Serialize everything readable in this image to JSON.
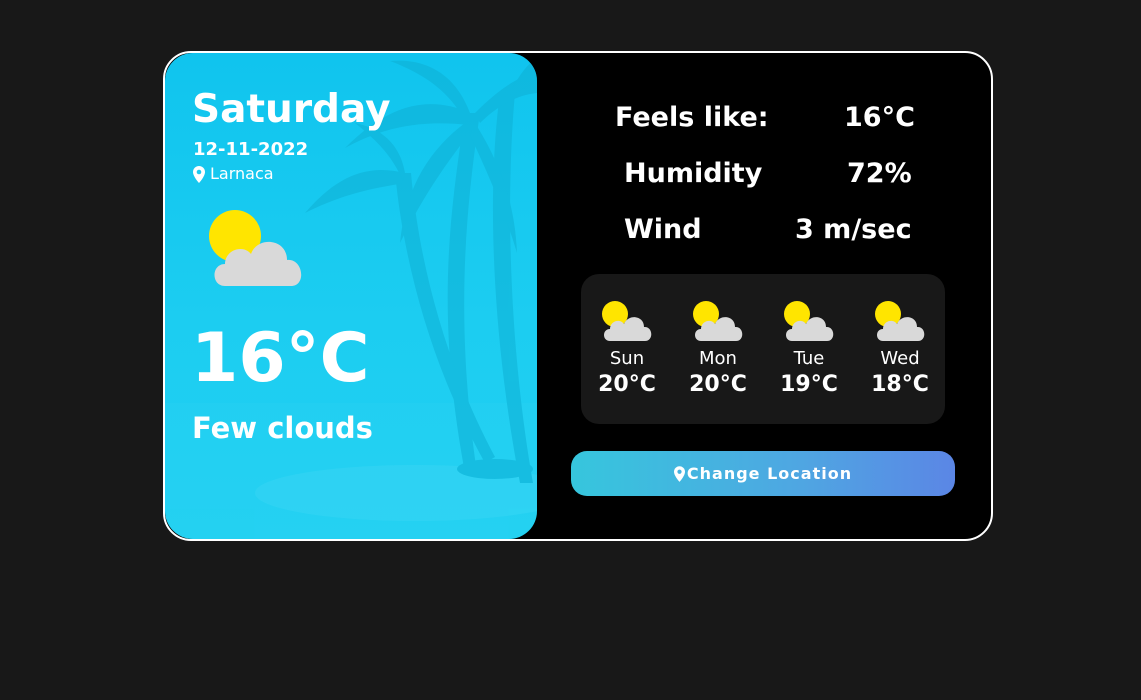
{
  "current": {
    "day": "Saturday",
    "date": "12-11-2022",
    "location": "Larnaca",
    "temperature": "16°C",
    "description": "Few clouds",
    "icon": "sun-behind-cloud-icon"
  },
  "stats": {
    "feels_like_label": "Feels like:",
    "feels_like_value": "16°C",
    "humidity_label": "Humidity",
    "humidity_value": "72%",
    "wind_label": "Wind",
    "wind_value": "3 m/sec"
  },
  "forecast": [
    {
      "day": "Sun",
      "temp": "20°C",
      "icon": "sun-behind-cloud-icon"
    },
    {
      "day": "Mon",
      "temp": "20°C",
      "icon": "sun-behind-cloud-icon"
    },
    {
      "day": "Tue",
      "temp": "19°C",
      "icon": "sun-behind-cloud-icon"
    },
    {
      "day": "Wed",
      "temp": "18°C",
      "icon": "sun-behind-cloud-icon"
    }
  ],
  "actions": {
    "change_location_label": "Change Location"
  },
  "colors": {
    "page_background": "#181818",
    "card_background": "#000000",
    "panel_accent": "#1cc9f0",
    "sun": "#ffe500",
    "cloud": "#d9d9d9",
    "button_gradient_start": "#36c6dd",
    "button_gradient_end": "#5b86e5"
  }
}
